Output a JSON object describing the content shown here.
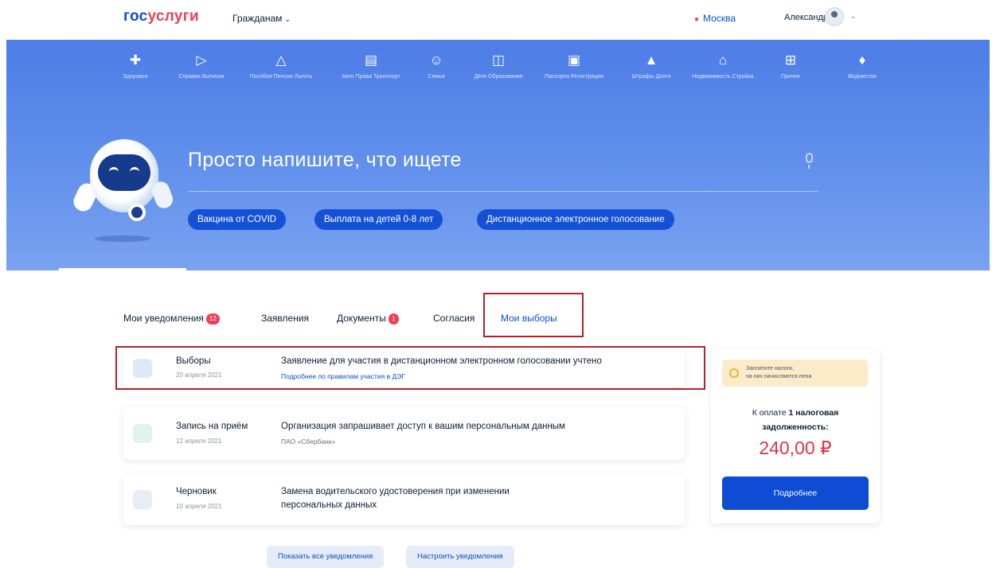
{
  "header": {
    "logo_part1": "гос",
    "logo_part2": "услуги",
    "citizens_label": "Гражданам",
    "location": "Москва",
    "user_name": "Александр С."
  },
  "categories": [
    {
      "icon": "health-icon",
      "label": "Здоровье"
    },
    {
      "icon": "folder-icon",
      "label": "Справки Выписки"
    },
    {
      "icon": "benefits-icon",
      "label": "Пособия Пенсии Льготы"
    },
    {
      "icon": "car-icon",
      "label": "Авто Права Транспорт"
    },
    {
      "icon": "family-icon",
      "label": "Семья"
    },
    {
      "icon": "book-icon",
      "label": "Дети Образование"
    },
    {
      "icon": "passport-icon",
      "label": "Паспорта Регистрация"
    },
    {
      "icon": "fines-icon",
      "label": "Штрафы Долги"
    },
    {
      "icon": "house-icon",
      "label": "Недвижимость Стройка"
    },
    {
      "icon": "grid-icon",
      "label": "Прочее"
    },
    {
      "icon": "emblem-icon",
      "label": "Ведомства"
    }
  ],
  "search": {
    "title": "Просто напишите, что ищете",
    "chips": [
      "Вакцина от COVID",
      "Выплата на детей 0-8 лет",
      "Дистанционное электронное голосование"
    ]
  },
  "tabs": {
    "notifications": "Мои уведомления",
    "notifications_count": "12",
    "applications": "Заявления",
    "documents": "Документы",
    "documents_count": "1",
    "consents": "Согласия",
    "elections": "Мои выборы"
  },
  "notifications": [
    {
      "title": "Выборы",
      "date": "20 апреля 2021",
      "text": "Заявление для участия в дистанционном электронном голосовании учтено",
      "sub": "Подробнее по правилам участия в ДЭГ"
    },
    {
      "title": "Запись на приём",
      "date": "12 апреля 2021",
      "text": "Организация запрашивает доступ к вашим персональным данным",
      "sub": "ПАО «Сбербанк»"
    },
    {
      "title": "Черновик",
      "date": "10 апреля 2021",
      "text_line1": "Замена водительского удостоверения при изменении",
      "text_line2": "персональных данных"
    }
  ],
  "widget": {
    "banner_line1": "Заплатите налоги,",
    "banner_line2": "на них начисляются пени",
    "due_line1_pre": "К оплате ",
    "due_line1_bold": "1 налоговая",
    "due_line2": "задолженность:",
    "amount": "240,00 ₽",
    "button": "Подробнее"
  },
  "bottom": {
    "show_all": "Показать все уведомления",
    "configure": "Настроить уведомления"
  },
  "colors": {
    "brand_blue": "#0d4cd3",
    "brand_red": "#ee3f58",
    "hero_blue": "#5a8ae9",
    "annotation_red": "#b1232c"
  }
}
